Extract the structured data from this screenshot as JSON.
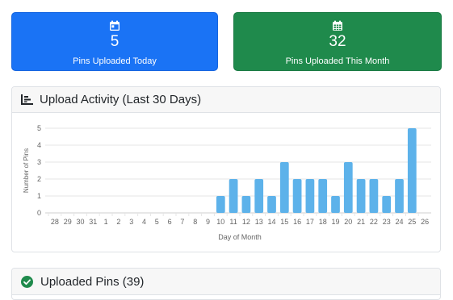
{
  "stats": {
    "today": {
      "value": "5",
      "label": "Pins Uploaded Today",
      "icon": "calendar-day-icon",
      "color": "#1a73f5"
    },
    "month": {
      "value": "32",
      "label": "Pins Uploaded This Month",
      "icon": "calendar-month-icon",
      "color": "#1f8a4c"
    }
  },
  "chart_panel": {
    "title": "Upload Activity (Last 30 Days)",
    "icon": "bar-chart-icon"
  },
  "pins_panel": {
    "title": "Uploaded Pins (39)",
    "icon": "check-circle-icon"
  },
  "chart_data": {
    "type": "bar",
    "categories": [
      "28",
      "29",
      "30",
      "31",
      "1",
      "2",
      "3",
      "4",
      "5",
      "6",
      "7",
      "8",
      "9",
      "10",
      "11",
      "12",
      "13",
      "14",
      "15",
      "16",
      "17",
      "18",
      "19",
      "20",
      "21",
      "22",
      "23",
      "24",
      "25",
      "26"
    ],
    "values": [
      0,
      0,
      0,
      0,
      0,
      0,
      0,
      0,
      0,
      0,
      0,
      0,
      0,
      1,
      2,
      1,
      2,
      1,
      3,
      2,
      2,
      2,
      1,
      3,
      2,
      2,
      1,
      2,
      5,
      0
    ],
    "xlabel": "Day of Month",
    "ylabel": "Number of Pins",
    "ylim": [
      0,
      5
    ],
    "yticks": [
      "0",
      "1",
      "2",
      "3",
      "4",
      "5"
    ],
    "grid": true,
    "bar_color": "#5db2ea"
  }
}
